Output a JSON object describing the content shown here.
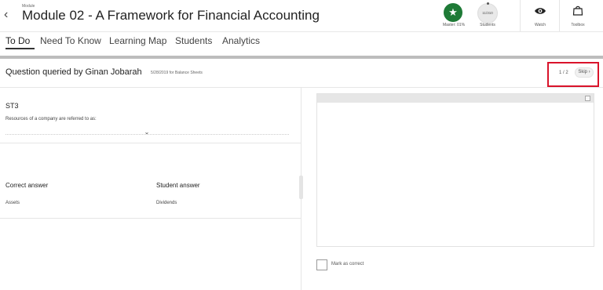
{
  "header": {
    "back_glyph": "‹",
    "module_label": "Module",
    "module_title": "Module 02 - A Framework for Financial Accounting",
    "mastery": {
      "label": "Master: 01%",
      "icon": "star-icon",
      "color": "#1e7a36"
    },
    "students": {
      "badge": "11/310",
      "label": "Students"
    },
    "watch": {
      "label": "Watch",
      "icon": "eye-icon"
    },
    "toolbox": {
      "label": "Toolbox",
      "icon": "bag-icon"
    }
  },
  "tabs": [
    {
      "label": "To Do",
      "active": true
    },
    {
      "label": "Need To Know",
      "active": false
    },
    {
      "label": "Learning Map",
      "active": false
    },
    {
      "label": "Students",
      "active": false
    },
    {
      "label": "Analytics",
      "active": false
    }
  ],
  "question": {
    "title": "Question queried by Ginan Jobarah",
    "meta": "5/28/2019 for Balance Sheets",
    "counter": "1 / 2",
    "skip_label": "Skip",
    "highlight_color": "#d9132a",
    "code": "ST3",
    "prompt": "Resources of a company are referred to as:",
    "correct_answer_heading": "Correct answer",
    "student_answer_heading": "Student answer",
    "correct_answer": "Assets",
    "student_answer": "Dividends"
  },
  "grading": {
    "mark_as_correct_label": "Mark as correct",
    "mark_as_correct_checked": false
  }
}
